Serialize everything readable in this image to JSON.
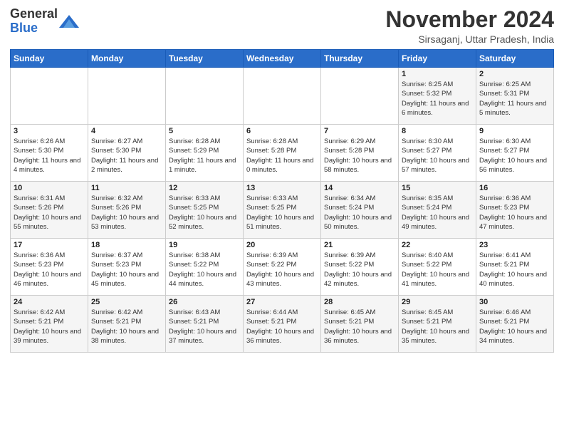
{
  "logo": {
    "general": "General",
    "blue": "Blue"
  },
  "header": {
    "month_title": "November 2024",
    "subtitle": "Sirsaganj, Uttar Pradesh, India"
  },
  "days_of_week": [
    "Sunday",
    "Monday",
    "Tuesday",
    "Wednesday",
    "Thursday",
    "Friday",
    "Saturday"
  ],
  "weeks": [
    [
      {
        "day": "",
        "info": ""
      },
      {
        "day": "",
        "info": ""
      },
      {
        "day": "",
        "info": ""
      },
      {
        "day": "",
        "info": ""
      },
      {
        "day": "",
        "info": ""
      },
      {
        "day": "1",
        "info": "Sunrise: 6:25 AM\nSunset: 5:32 PM\nDaylight: 11 hours and 6 minutes."
      },
      {
        "day": "2",
        "info": "Sunrise: 6:25 AM\nSunset: 5:31 PM\nDaylight: 11 hours and 5 minutes."
      }
    ],
    [
      {
        "day": "3",
        "info": "Sunrise: 6:26 AM\nSunset: 5:30 PM\nDaylight: 11 hours and 4 minutes."
      },
      {
        "day": "4",
        "info": "Sunrise: 6:27 AM\nSunset: 5:30 PM\nDaylight: 11 hours and 2 minutes."
      },
      {
        "day": "5",
        "info": "Sunrise: 6:28 AM\nSunset: 5:29 PM\nDaylight: 11 hours and 1 minute."
      },
      {
        "day": "6",
        "info": "Sunrise: 6:28 AM\nSunset: 5:28 PM\nDaylight: 11 hours and 0 minutes."
      },
      {
        "day": "7",
        "info": "Sunrise: 6:29 AM\nSunset: 5:28 PM\nDaylight: 10 hours and 58 minutes."
      },
      {
        "day": "8",
        "info": "Sunrise: 6:30 AM\nSunset: 5:27 PM\nDaylight: 10 hours and 57 minutes."
      },
      {
        "day": "9",
        "info": "Sunrise: 6:30 AM\nSunset: 5:27 PM\nDaylight: 10 hours and 56 minutes."
      }
    ],
    [
      {
        "day": "10",
        "info": "Sunrise: 6:31 AM\nSunset: 5:26 PM\nDaylight: 10 hours and 55 minutes."
      },
      {
        "day": "11",
        "info": "Sunrise: 6:32 AM\nSunset: 5:26 PM\nDaylight: 10 hours and 53 minutes."
      },
      {
        "day": "12",
        "info": "Sunrise: 6:33 AM\nSunset: 5:25 PM\nDaylight: 10 hours and 52 minutes."
      },
      {
        "day": "13",
        "info": "Sunrise: 6:33 AM\nSunset: 5:25 PM\nDaylight: 10 hours and 51 minutes."
      },
      {
        "day": "14",
        "info": "Sunrise: 6:34 AM\nSunset: 5:24 PM\nDaylight: 10 hours and 50 minutes."
      },
      {
        "day": "15",
        "info": "Sunrise: 6:35 AM\nSunset: 5:24 PM\nDaylight: 10 hours and 49 minutes."
      },
      {
        "day": "16",
        "info": "Sunrise: 6:36 AM\nSunset: 5:23 PM\nDaylight: 10 hours and 47 minutes."
      }
    ],
    [
      {
        "day": "17",
        "info": "Sunrise: 6:36 AM\nSunset: 5:23 PM\nDaylight: 10 hours and 46 minutes."
      },
      {
        "day": "18",
        "info": "Sunrise: 6:37 AM\nSunset: 5:23 PM\nDaylight: 10 hours and 45 minutes."
      },
      {
        "day": "19",
        "info": "Sunrise: 6:38 AM\nSunset: 5:22 PM\nDaylight: 10 hours and 44 minutes."
      },
      {
        "day": "20",
        "info": "Sunrise: 6:39 AM\nSunset: 5:22 PM\nDaylight: 10 hours and 43 minutes."
      },
      {
        "day": "21",
        "info": "Sunrise: 6:39 AM\nSunset: 5:22 PM\nDaylight: 10 hours and 42 minutes."
      },
      {
        "day": "22",
        "info": "Sunrise: 6:40 AM\nSunset: 5:22 PM\nDaylight: 10 hours and 41 minutes."
      },
      {
        "day": "23",
        "info": "Sunrise: 6:41 AM\nSunset: 5:21 PM\nDaylight: 10 hours and 40 minutes."
      }
    ],
    [
      {
        "day": "24",
        "info": "Sunrise: 6:42 AM\nSunset: 5:21 PM\nDaylight: 10 hours and 39 minutes."
      },
      {
        "day": "25",
        "info": "Sunrise: 6:42 AM\nSunset: 5:21 PM\nDaylight: 10 hours and 38 minutes."
      },
      {
        "day": "26",
        "info": "Sunrise: 6:43 AM\nSunset: 5:21 PM\nDaylight: 10 hours and 37 minutes."
      },
      {
        "day": "27",
        "info": "Sunrise: 6:44 AM\nSunset: 5:21 PM\nDaylight: 10 hours and 36 minutes."
      },
      {
        "day": "28",
        "info": "Sunrise: 6:45 AM\nSunset: 5:21 PM\nDaylight: 10 hours and 36 minutes."
      },
      {
        "day": "29",
        "info": "Sunrise: 6:45 AM\nSunset: 5:21 PM\nDaylight: 10 hours and 35 minutes."
      },
      {
        "day": "30",
        "info": "Sunrise: 6:46 AM\nSunset: 5:21 PM\nDaylight: 10 hours and 34 minutes."
      }
    ]
  ]
}
